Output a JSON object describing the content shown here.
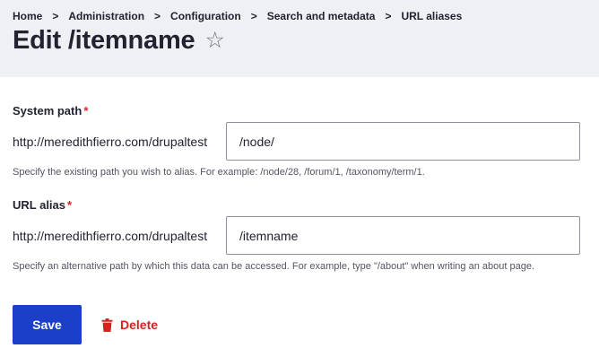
{
  "breadcrumb": {
    "items": [
      "Home",
      "Administration",
      "Configuration",
      "Search and metadata",
      "URL aliases"
    ],
    "separator": ">"
  },
  "page": {
    "title": "Edit /itemname",
    "favorite_icon": "star-outline-icon"
  },
  "form": {
    "system_path": {
      "label": "System path",
      "required_mark": "*",
      "prefix": "http://meredithfierro.com/drupaltest",
      "value": "/node/",
      "description": "Specify the existing path you wish to alias. For example: /node/28, /forum/1, /taxonomy/term/1."
    },
    "url_alias": {
      "label": "URL alias",
      "required_mark": "*",
      "prefix": "http://meredithfierro.com/drupaltest",
      "value": "/itemname",
      "description": "Specify an alternative path by which this data can be accessed. For example, type \"/about\" when writing an about page."
    }
  },
  "actions": {
    "save_label": "Save",
    "delete_label": "Delete",
    "delete_icon": "trash-icon"
  },
  "colors": {
    "header_bg": "#eef0f4",
    "primary": "#1b3fc8",
    "danger": "#d72222"
  }
}
